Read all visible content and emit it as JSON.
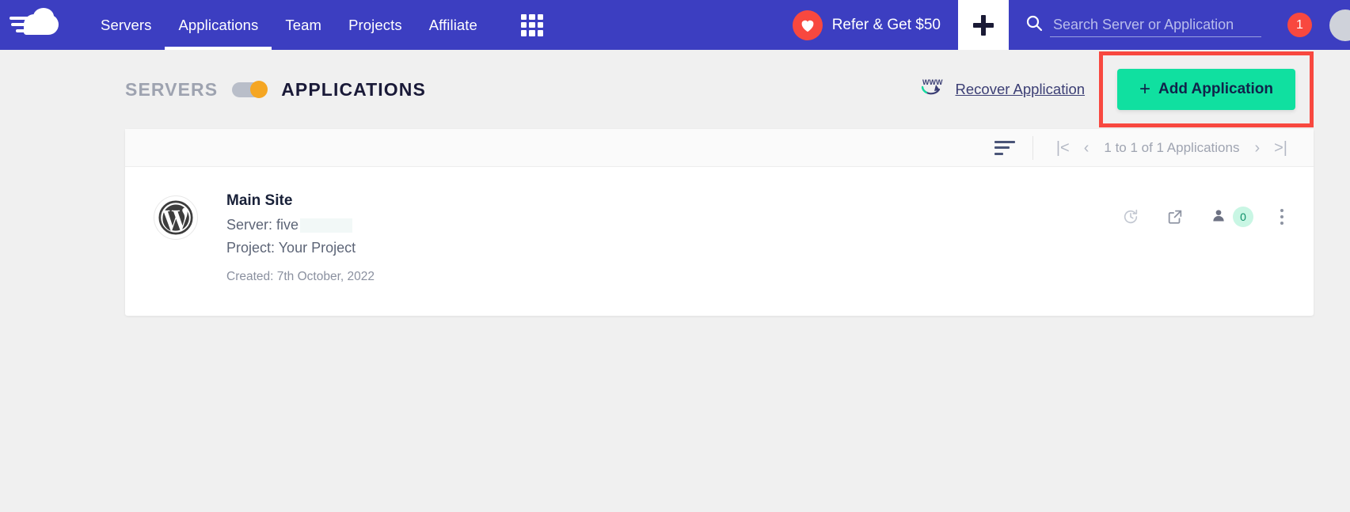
{
  "topnav": {
    "logo_name": "cloudways-logo",
    "links": [
      {
        "label": "Servers",
        "active": false
      },
      {
        "label": "Applications",
        "active": true
      },
      {
        "label": "Team",
        "active": false
      },
      {
        "label": "Projects",
        "active": false
      },
      {
        "label": "Affiliate",
        "active": false
      }
    ],
    "apps_grid_icon": "grid-apps-icon",
    "refer_label": "Refer & Get $50",
    "add_icon_label": "+",
    "search_placeholder": "Search Server or Application",
    "search_value": "",
    "notification_count": "1",
    "accent_blue": "#3c3ec1",
    "accent_red": "#f8483f"
  },
  "page_head": {
    "segment_left": "SERVERS",
    "segment_right": "APPLICATIONS",
    "toggle_state": "applications",
    "toggle_knob_color": "#f5a623",
    "recover_label": "Recover Application",
    "add_application_label": "Add Application",
    "add_button_color": "#10e0a0",
    "highlight_color": "#f8483f"
  },
  "panel": {
    "sort_icon": "sort-icon",
    "pagination": {
      "first_label": "|<",
      "prev_label": "‹",
      "text": "1 to 1 of 1 Applications",
      "next_label": "›",
      "last_label": ">|"
    },
    "applications": [
      {
        "platform_icon": "wordpress-icon",
        "name": "Main Site",
        "server_label": "Server: five",
        "project_label": "Project: Your Project",
        "created_label": "Created: 7th October, 2022",
        "actions": {
          "restore_icon": "restore-clock-icon",
          "launch_icon": "external-link-icon",
          "users_icon": "user-icon",
          "users_count": "0",
          "menu_icon": "kebab-menu-icon"
        }
      }
    ]
  }
}
